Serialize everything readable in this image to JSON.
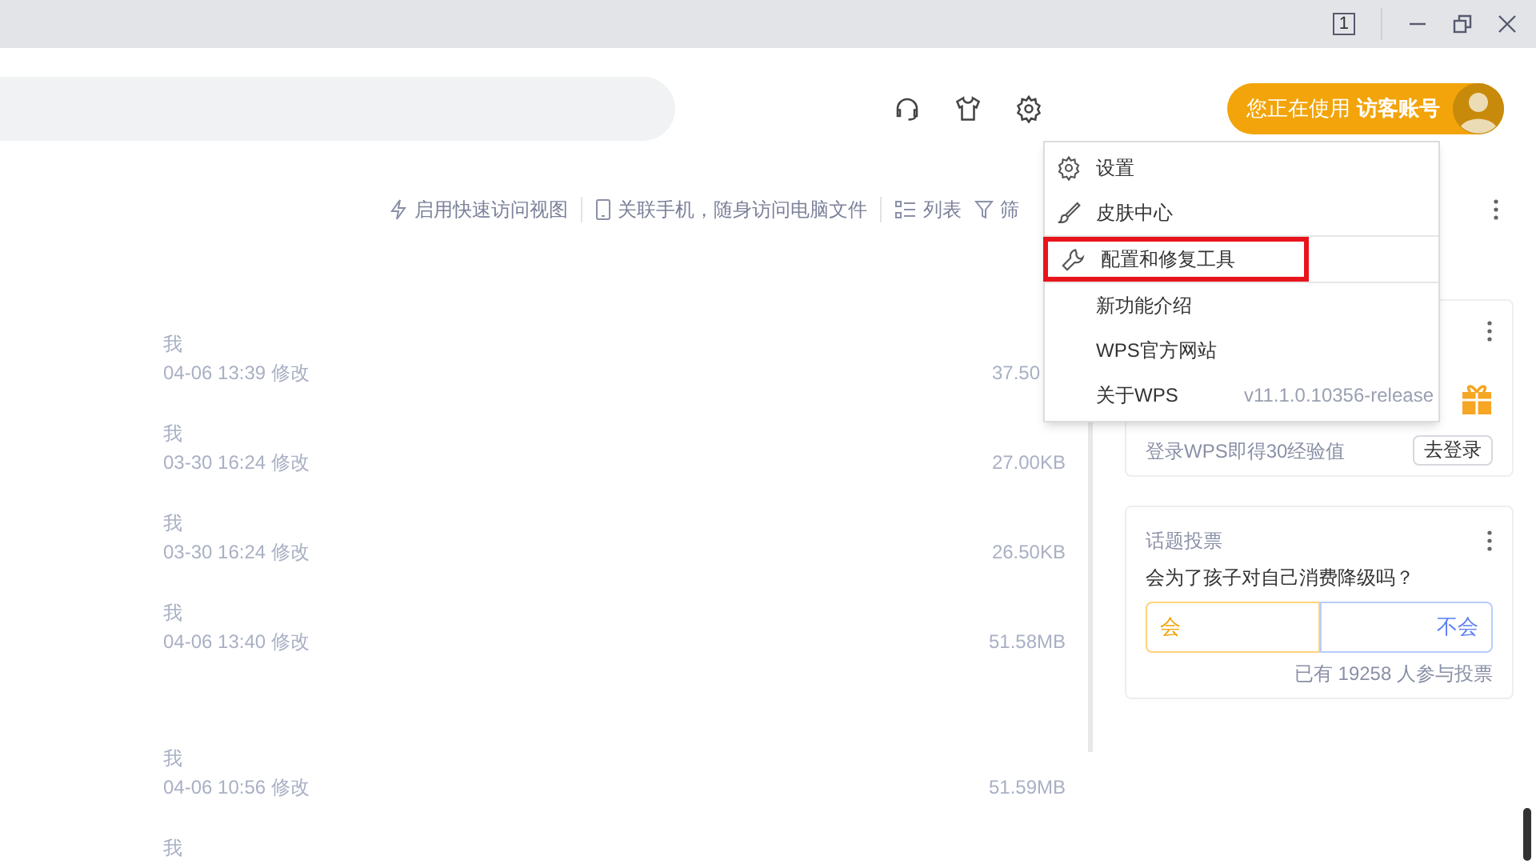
{
  "title_bar": {
    "page_count": "1"
  },
  "header": {
    "account": {
      "prefix": "您正在使用",
      "name": "访客账号"
    }
  },
  "toolbar": {
    "items": [
      {
        "label": "启用快速访问视图"
      },
      {
        "label": "关联手机，随身访问电脑文件"
      },
      {
        "label": "列表"
      },
      {
        "label": "筛"
      }
    ]
  },
  "file_groups": [
    [
      {
        "owner": "我",
        "modified": "04-06 13:39 修改",
        "size": "37.50"
      },
      {
        "owner": "我",
        "modified": "03-30 16:24 修改",
        "size": "27.00KB"
      },
      {
        "owner": "我",
        "modified": "03-30 16:24 修改",
        "size": "26.50KB"
      },
      {
        "owner": "我",
        "modified": "04-06 13:40 修改",
        "size": "51.58MB"
      }
    ],
    [
      {
        "owner": "我",
        "modified": "04-06 10:56 修改",
        "size": "51.59MB"
      },
      {
        "owner": "我"
      }
    ]
  ],
  "menu": {
    "items": [
      {
        "label": "设置",
        "separator_after": false,
        "annotated": false
      },
      {
        "label": "皮肤中心",
        "separator_after": true,
        "annotated": false
      },
      {
        "label": "配置和修复工具",
        "separator_after": true,
        "annotated": true
      },
      {
        "label": "新功能介绍",
        "separator_after": false,
        "annotated": false
      },
      {
        "label": "WPS官方网站",
        "separator_after": false,
        "annotated": false
      },
      {
        "label": "关于WPS",
        "version": "v11.1.0.10356-release",
        "separator_after": false,
        "annotated": false
      }
    ]
  },
  "login_card": {
    "text": "登录WPS即得30经验值",
    "button": "去登录"
  },
  "poll_card": {
    "title": "话题投票",
    "question": "会为了孩子对自己消费降级吗？",
    "options": [
      "会",
      "不会"
    ],
    "participants": "已有 19258 人参与投票"
  }
}
